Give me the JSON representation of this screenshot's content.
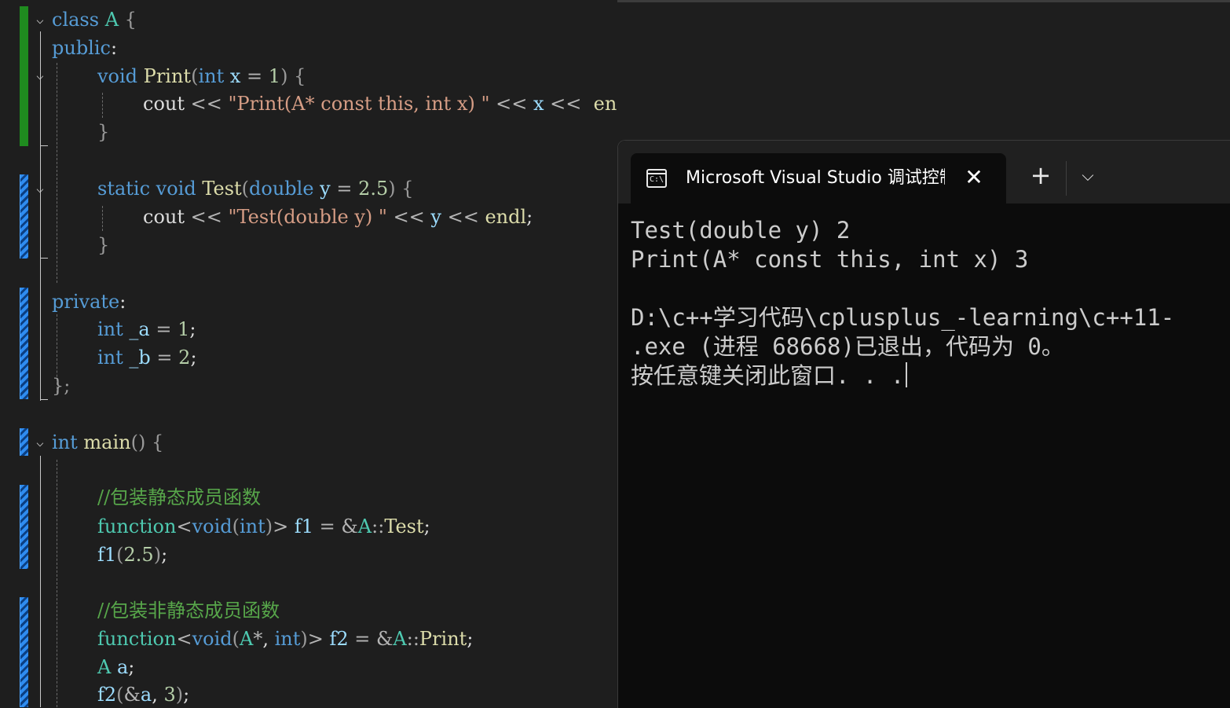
{
  "editor": {
    "lines": {
      "class_kw": "class",
      "class_name": " A",
      "class_brace": " {",
      "public_kw": "public",
      "public_colon": ":",
      "p_void": "void",
      "p_name": " Print",
      "p_open": "(",
      "p_int": "int",
      "p_x": " x",
      "p_eq": " = ",
      "p_one": "1",
      "p_close": ")",
      "p_brace": " {",
      "c1_cout": "cout",
      "c1_op": " << ",
      "c1_str": "\"Print(A* const this, int x) \"",
      "c1_op2": " << ",
      "c1_x": "x",
      "c1_op3": " << ",
      "c1_endl": " endl",
      "c1_semi": ";",
      "close1": "}",
      "s_static": "static",
      "s_void": " void",
      "s_name": " Test",
      "s_open": "(",
      "s_double": "double",
      "s_y": " y",
      "s_eq": " = ",
      "s_val": "2.5",
      "s_close": ")",
      "s_brace": " {",
      "c2_cout": "cout",
      "c2_op": " << ",
      "c2_str": "\"Test(double y) \"",
      "c2_op2": " << ",
      "c2_y": "y",
      "c2_op3": " << ",
      "c2_endl": "endl",
      "c2_semi": ";",
      "close2": "}",
      "private_kw": "private",
      "private_colon": ":",
      "a_int": "int",
      "a_name": " _a",
      "a_eq": " = ",
      "a_val": "1",
      "a_semi": ";",
      "b_int": "int",
      "b_name": " _b",
      "b_eq": " = ",
      "b_val": "2",
      "b_semi": ";",
      "class_end": "};",
      "main_int": "int",
      "main_name": " main",
      "main_paren": "()",
      "main_brace": " {",
      "comment1": "//包装静态成员函数",
      "f1_func": "function",
      "f1_lt": "<",
      "f1_void": "void",
      "f1_open": "(",
      "f1_int": "int",
      "f1_close": ")",
      "f1_gt": ">",
      "f1_name": " f1",
      "f1_eq": " = ",
      "f1_amp": "&",
      "f1_a": "A",
      "f1_scope": "::",
      "f1_test": "Test",
      "f1_semi": ";",
      "call1_name": "f1",
      "call1_open": "(",
      "call1_val": "2.5",
      "call1_close": ")",
      "call1_semi": ";",
      "comment2": "//包装非静态成员函数",
      "f2_func": "function",
      "f2_lt": "<",
      "f2_void": "void",
      "f2_open": "(",
      "f2_a": "A",
      "f2_star": "*",
      "f2_comma": ", ",
      "f2_int": "int",
      "f2_close": ")",
      "f2_gt": ">",
      "f2_name": " f2",
      "f2_eq": " = ",
      "f2_amp": "&",
      "f2_aa": "A",
      "f2_scope": "::",
      "f2_print": "Print",
      "f2_semi": ";",
      "obj_type": "A",
      "obj_name": " a",
      "obj_semi": ";",
      "call2_name": "f2",
      "call2_open": "(",
      "call2_amp": "&",
      "call2_a": "a",
      "call2_comma": ", ",
      "call2_val": "3",
      "call2_close": ")",
      "call2_semi": ";"
    }
  },
  "console": {
    "tab_title": "Microsoft Visual Studio 调试控制台",
    "tab_icon_text": "C:\\",
    "close_glyph": "✕",
    "new_tab_glyph": "+",
    "dropdown_glyph": "⌵",
    "output": [
      "Test(double y) 2",
      "Print(A* const this, int x) 3",
      "",
      "D:\\c++学习代码\\cplusplus_-learning\\c++11-",
      ".exe (进程 68668)已退出，代码为 0。",
      "按任意键关闭此窗口. . ."
    ]
  },
  "colors": {
    "keyword": "#569cd6",
    "function": "#dcdcaa",
    "string": "#d69d85",
    "number": "#b5cea8",
    "comment": "#57a64a",
    "type": "#4ec9b0",
    "saved_marker": "#1f8b1f",
    "unsaved_marker": "#2f8cf0"
  }
}
